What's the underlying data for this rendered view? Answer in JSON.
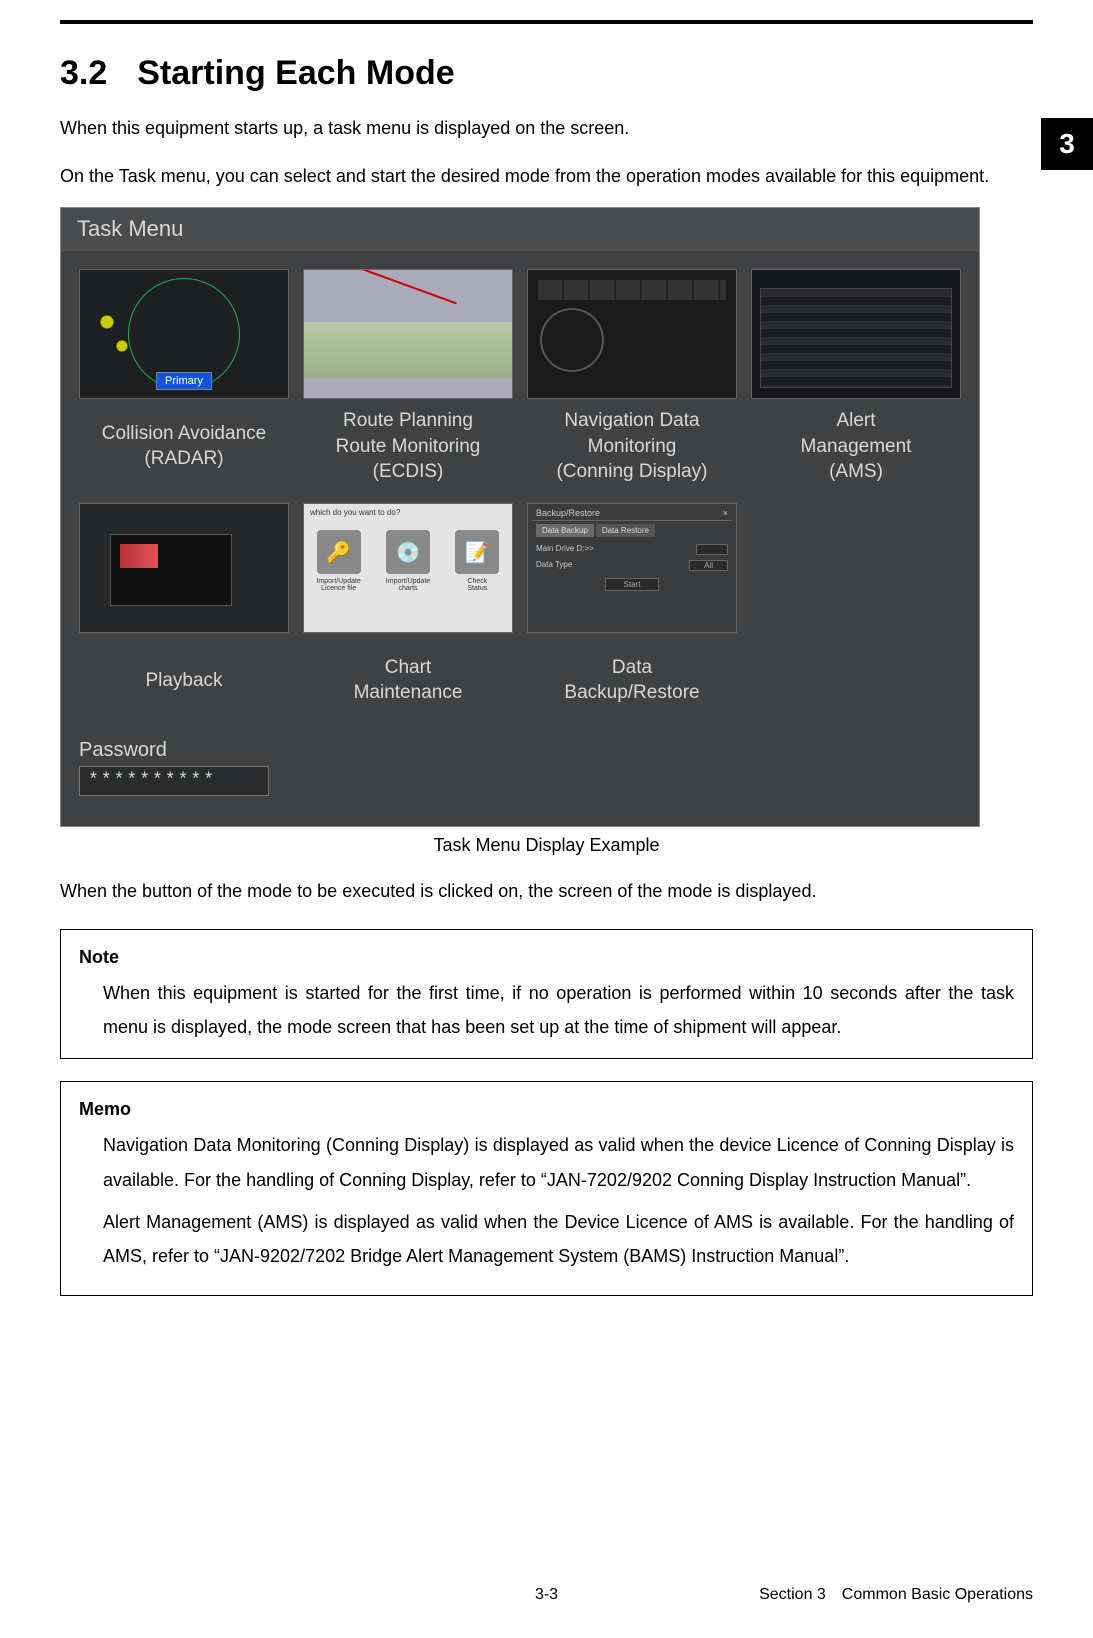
{
  "chapter_tab": "3",
  "section_number": "3.2",
  "section_title": "Starting Each Mode",
  "intro_line1": "When this equipment starts up, a task menu is displayed on the screen.",
  "intro_line2": "On the Task menu, you can select and start the desired mode from the operation modes available for this equipment.",
  "task_menu": {
    "title": "Task Menu",
    "primary_badge": "Primary",
    "tiles_row1": [
      "Collision Avoidance\n(RADAR)",
      "Route Planning\nRoute Monitoring\n(ECDIS)",
      "Navigation Data\nMonitoring\n(Conning Display)",
      "Alert\nManagement\n(AMS)"
    ],
    "tiles_row2": [
      "Playback",
      "Chart\nMaintenance",
      "Data\nBackup/Restore"
    ],
    "maint_prompt": "which do you want to do?",
    "maint_opts": [
      "Import/Update\nLicence file",
      "Import/Update\ncharts",
      "Check\nStatus"
    ],
    "backup": {
      "title": "Backup/Restore",
      "close": "×",
      "tab1": "Data Backup",
      "tab2": "Data Restore",
      "row1_label": "Main Drive D:>>",
      "row2_label": "Data Type",
      "row2_value": "All",
      "button": "Start"
    },
    "password_label": "Password",
    "password_value": "**********"
  },
  "caption": "Task Menu Display Example",
  "after_caption": "When the button of the mode to be executed is clicked on, the screen of the mode is displayed.",
  "note": {
    "title": "Note",
    "body": "When this equipment is started for the first time, if no operation is performed within 10 seconds after the task menu is displayed, the mode screen that has been set up at the time of shipment will appear."
  },
  "memo": {
    "title": "Memo",
    "p1": "Navigation Data Monitoring (Conning Display) is displayed as valid when the device Licence of Conning Display is available. For the handling of Conning Display, refer to “JAN-7202/9202 Conning Display Instruction Manual”.",
    "p2": "Alert Management (AMS) is displayed as valid when the Device Licence of AMS is available. For the handling of AMS, refer to “JAN-9202/7202 Bridge Alert Management System (BAMS) Instruction Manual”."
  },
  "footer": {
    "page": "3-3",
    "section": "Section 3 Common Basic Operations"
  }
}
